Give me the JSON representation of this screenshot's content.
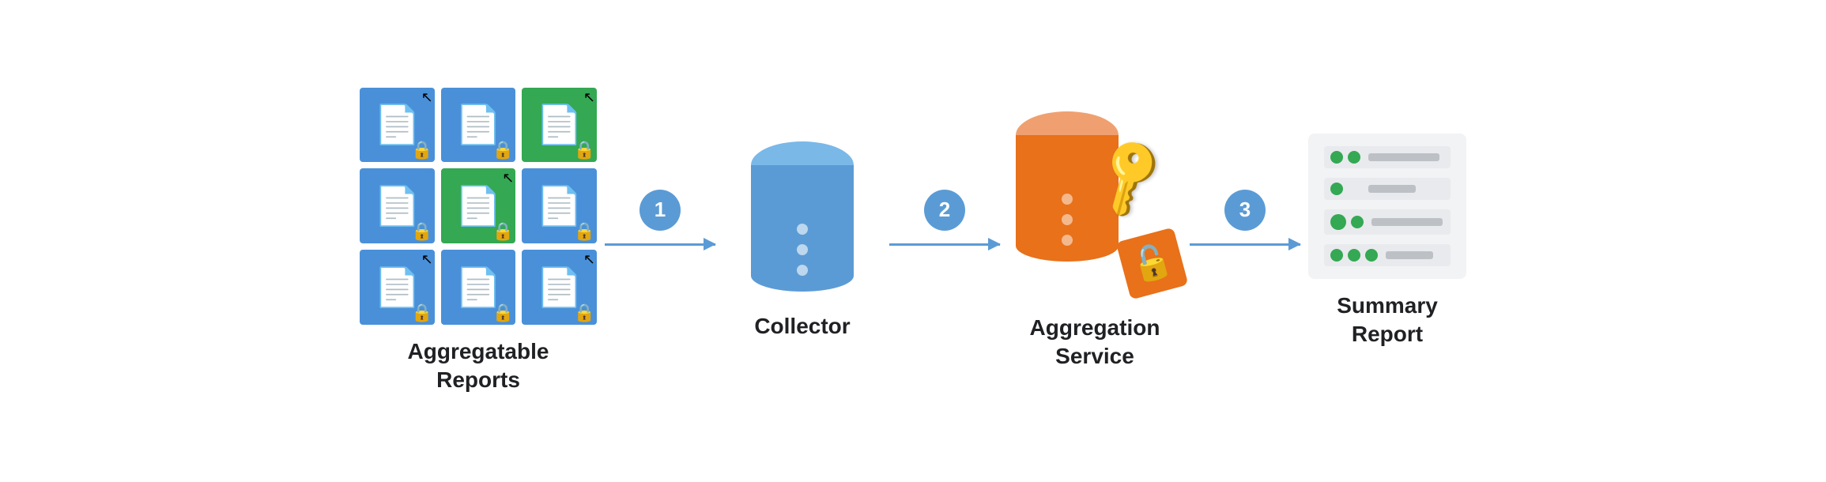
{
  "diagram": {
    "nodes": [
      {
        "id": "aggregatable-reports",
        "label_line1": "Aggregatable",
        "label_line2": "Reports"
      },
      {
        "id": "collector",
        "label_line1": "Collector",
        "label_line2": ""
      },
      {
        "id": "aggregation-service",
        "label_line1": "Aggregation",
        "label_line2": "Service"
      },
      {
        "id": "summary-report",
        "label_line1": "Summary",
        "label_line2": "Report"
      }
    ],
    "arrows": [
      {
        "step": "1"
      },
      {
        "step": "2"
      },
      {
        "step": "3"
      }
    ],
    "colors": {
      "blue": "#5b9bd5",
      "blue_light": "#7ab8e8",
      "green": "#34a853",
      "orange": "#e8711a",
      "orange_light": "#f0a070",
      "yellow": "#f4b400",
      "gray_bg": "#f1f3f4",
      "text_dark": "#202124"
    }
  }
}
